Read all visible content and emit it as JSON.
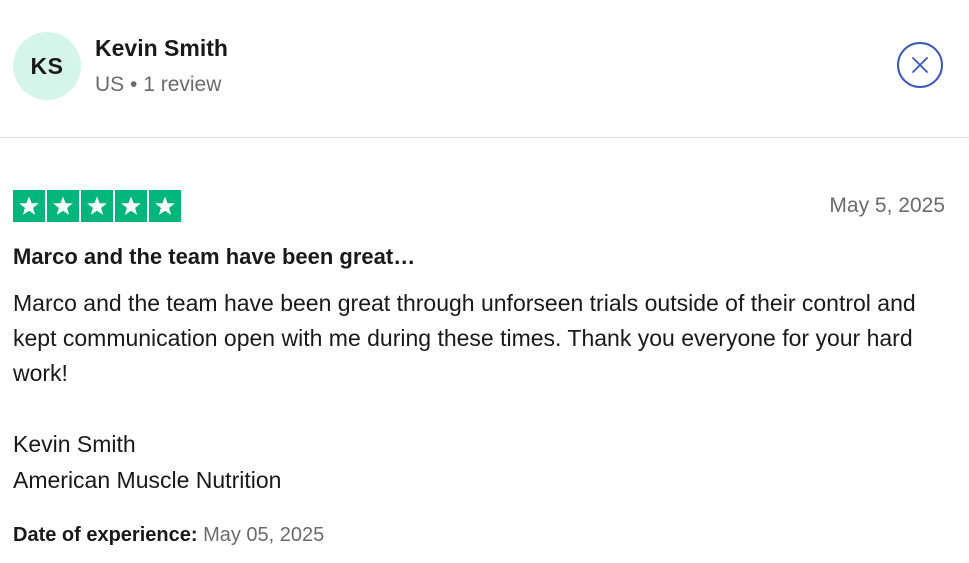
{
  "reviewer": {
    "initials": "KS",
    "name": "Kevin Smith",
    "meta": "US • 1 review"
  },
  "review": {
    "rating": 5,
    "date": "May 5, 2025",
    "title": "Marco and the team have been great…",
    "body": "Marco and the team have been great through unforseen trials outside of their control and kept communication open with me during these times. Thank you everyone for your hard work!",
    "signature_name": "Kevin Smith",
    "signature_company": "American Muscle Nutrition",
    "experience_label": "Date of experience:",
    "experience_date": "May 05, 2025"
  },
  "colors": {
    "star_green": "#00b67a",
    "avatar_bg": "#d6f5ea",
    "close_blue": "#3c57bc"
  },
  "icons": {
    "close": "close-icon",
    "star": "star-icon"
  }
}
